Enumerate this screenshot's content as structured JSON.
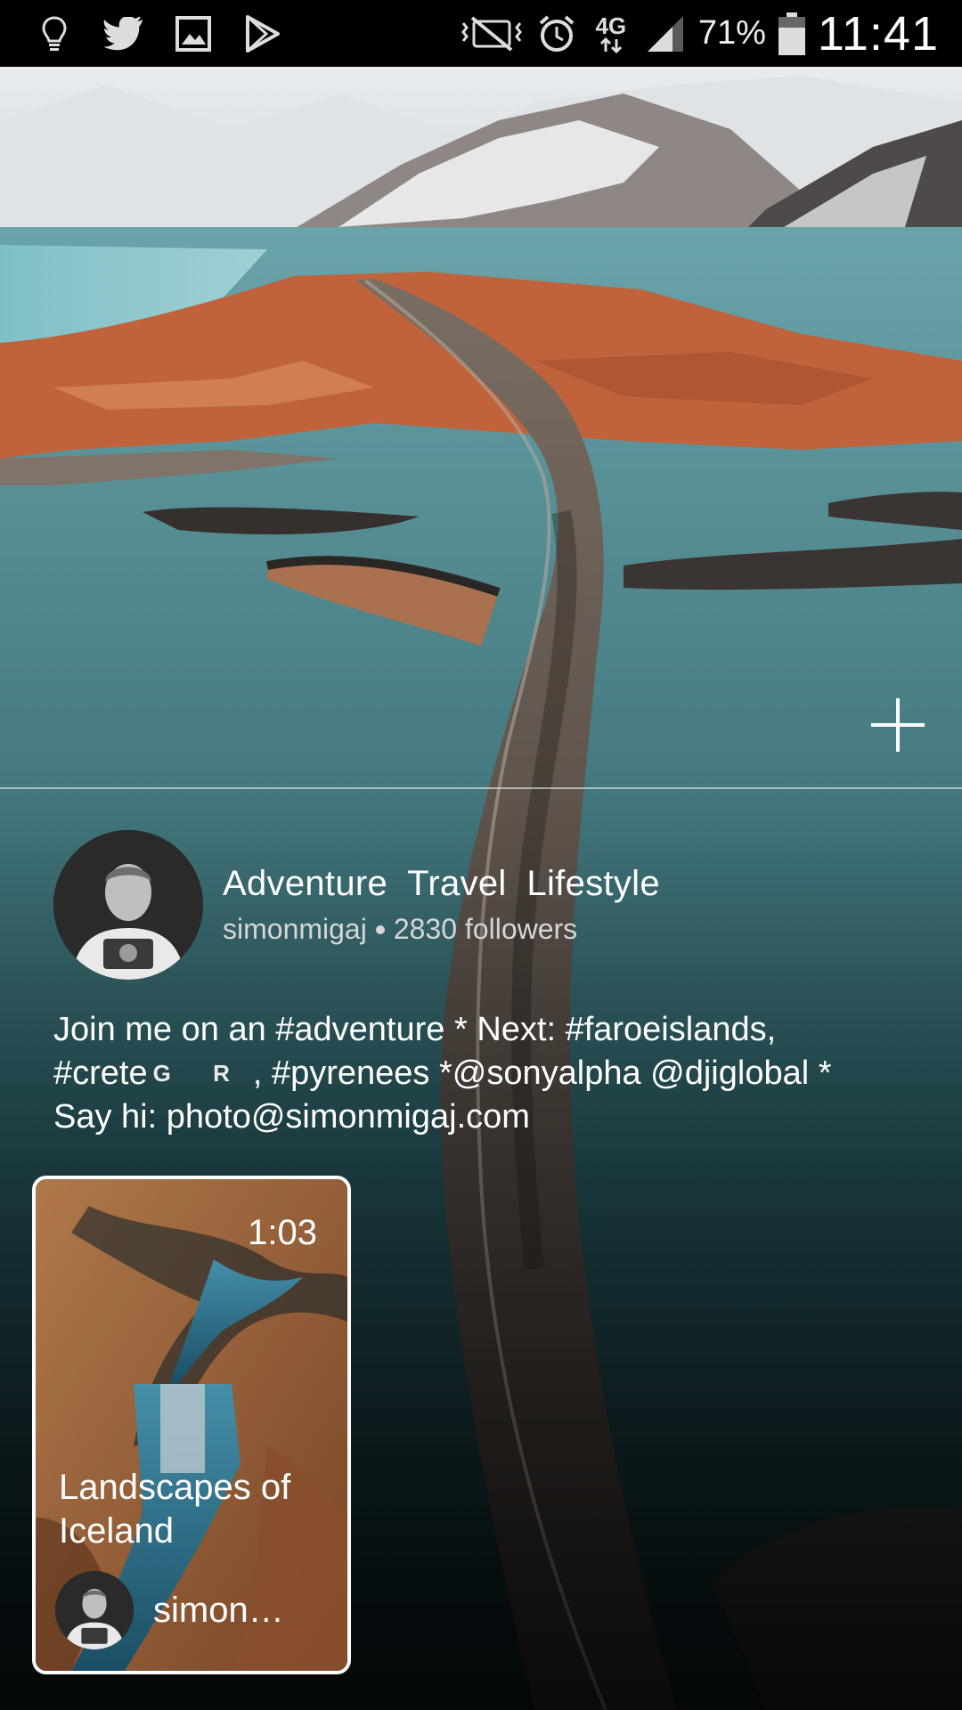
{
  "status_bar": {
    "icons_left": [
      "lightbulb-icon",
      "twitter-icon",
      "gallery-icon",
      "play-store-icon"
    ],
    "icons_right": [
      "vibrate-mute-icon",
      "alarm-icon",
      "network-4g-icon",
      "signal-icon",
      "battery-icon"
    ],
    "network": "4G",
    "battery": "71%",
    "battery_level": 0.71,
    "time": "11:41"
  },
  "profile": {
    "title": "Adventure  Travel  Lifestyle",
    "username": "simonmigaj",
    "followers": "2830 followers"
  },
  "bio": {
    "line1": "Join me on an #adventure * Next: #faroeislands,",
    "line2_a": "#crete",
    "line2_flag": "G R",
    "line2_b": ", #pyrenees *@sonyalpha @djiglobal *",
    "line3": "Say hi: photo@simonmigaj.com"
  },
  "story": {
    "duration": "1:03",
    "title": "Landscapes of Iceland",
    "author": "simon…"
  },
  "colors": {
    "status_bar_bg": "#000000",
    "text": "#ffffff",
    "sea": "#2a5a60",
    "land": "#c0633c"
  }
}
